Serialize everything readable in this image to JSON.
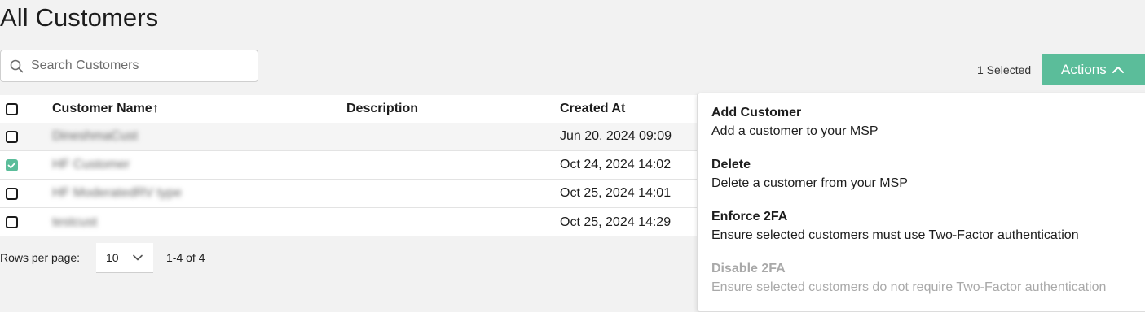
{
  "page": {
    "title": "All Customers"
  },
  "search": {
    "placeholder": "Search Customers",
    "value": ""
  },
  "toolbar": {
    "selected_count": "1 Selected",
    "actions_label": "Actions"
  },
  "table": {
    "headers": {
      "name": "Customer Name",
      "sort_indicator": "↑",
      "description": "Description",
      "created_at": "Created At"
    },
    "rows": [
      {
        "name": "DineshmaCust",
        "description": "",
        "created_at": "Jun 20, 2024 09:09",
        "checked": false
      },
      {
        "name": "HF Customer",
        "description": "",
        "created_at": "Oct 24, 2024 14:02",
        "checked": true
      },
      {
        "name": "HF ModeratedRV type",
        "description": "",
        "created_at": "Oct 25, 2024 14:01",
        "checked": false
      },
      {
        "name": "testcust",
        "description": "",
        "created_at": "Oct 25, 2024 14:29",
        "checked": false
      }
    ]
  },
  "pagination": {
    "rows_per_page_label": "Rows per page:",
    "rows_per_page": "10",
    "range": "1-4 of 4"
  },
  "actions_menu": {
    "items": [
      {
        "title": "Add Customer",
        "description": "Add a customer to your MSP",
        "disabled": false
      },
      {
        "title": "Delete",
        "description": "Delete a customer from your MSP",
        "disabled": false
      },
      {
        "title": "Enforce 2FA",
        "description": "Ensure selected customers must use Two-Factor authentication",
        "disabled": false
      },
      {
        "title": "Disable 2FA",
        "description": "Ensure selected customers do not require Two-Factor authentication",
        "disabled": true
      }
    ]
  },
  "colors": {
    "accent": "#5bbd9a",
    "background": "#f2f2f2",
    "disabled_text": "#a9a9a9"
  },
  "icons": {
    "search": "search-icon",
    "actions_chevron": "chevron-up-icon",
    "select_chevron": "chevron-down-icon",
    "check": "check-icon"
  }
}
